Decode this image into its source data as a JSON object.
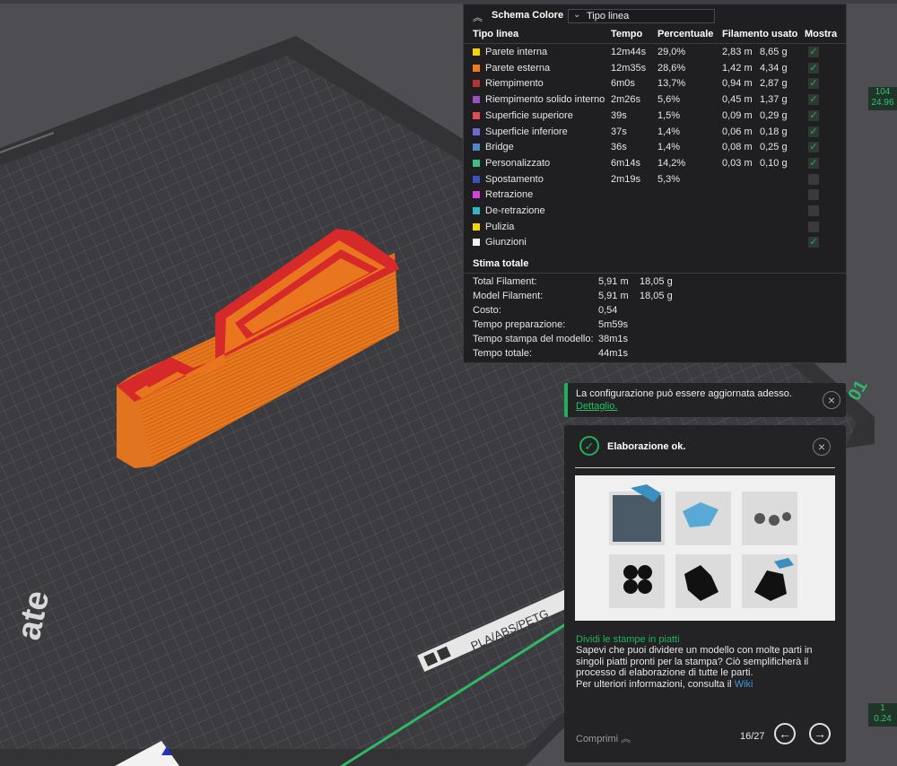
{
  "legend": {
    "title": "Schema Colore",
    "view_select": "Tipo linea",
    "columns": [
      "Tipo linea",
      "Tempo",
      "Percentuale",
      "Filamento usato",
      "Mostra"
    ],
    "rows": [
      {
        "label": "Parete interna",
        "color": "#f5d200",
        "time": "12m44s",
        "percent": "29,0%",
        "meters": "2,83 m",
        "grams": "8,65 g",
        "shown": true
      },
      {
        "label": "Parete esterna",
        "color": "#f07a1e",
        "time": "12m35s",
        "percent": "28,6%",
        "meters": "1,42 m",
        "grams": "4,34 g",
        "shown": true
      },
      {
        "label": "Riempimento",
        "color": "#b5332c",
        "time": "6m0s",
        "percent": "13,7%",
        "meters": "0,94 m",
        "grams": "2,87 g",
        "shown": true
      },
      {
        "label": "Riempimento solido interno",
        "color": "#9b4fc4",
        "time": "2m26s",
        "percent": "5,6%",
        "meters": "0,45 m",
        "grams": "1,37 g",
        "shown": true
      },
      {
        "label": "Superficie superiore",
        "color": "#e84b4b",
        "time": "39s",
        "percent": "1,5%",
        "meters": "0,09 m",
        "grams": "0,29 g",
        "shown": true
      },
      {
        "label": "Superficie inferiore",
        "color": "#6b6bd6",
        "time": "37s",
        "percent": "1,4%",
        "meters": "0,06 m",
        "grams": "0,18 g",
        "shown": true
      },
      {
        "label": "Bridge",
        "color": "#4f86c6",
        "time": "36s",
        "percent": "1,4%",
        "meters": "0,08 m",
        "grams": "0,25 g",
        "shown": true
      },
      {
        "label": "Personalizzato",
        "color": "#3fbf7f",
        "time": "6m14s",
        "percent": "14,2%",
        "meters": "0,03 m",
        "grams": "0,10 g",
        "shown": true
      },
      {
        "label": "Spostamento",
        "color": "#3d52b8",
        "time": "2m19s",
        "percent": "5,3%",
        "meters": "",
        "grams": "",
        "shown": false
      },
      {
        "label": "Retrazione",
        "color": "#d93fd9",
        "time": "",
        "percent": "",
        "meters": "",
        "grams": "",
        "shown": false
      },
      {
        "label": "De-retrazione",
        "color": "#2fb8c6",
        "time": "",
        "percent": "",
        "meters": "",
        "grams": "",
        "shown": false
      },
      {
        "label": "Pulizia",
        "color": "#f0d800",
        "time": "",
        "percent": "",
        "meters": "",
        "grams": "",
        "shown": false
      },
      {
        "label": "Giunzioni",
        "color": "#f2f2f2",
        "time": "",
        "percent": "",
        "meters": "",
        "grams": "",
        "shown": true
      }
    ],
    "estimate_title": "Stima totale",
    "estimates": [
      {
        "key": "Total Filament:",
        "v1": "5,91 m",
        "v2": "18,05 g"
      },
      {
        "key": "Model Filament:",
        "v1": "5,91 m",
        "v2": "18,05 g"
      },
      {
        "key": "Costo:",
        "v1": "0,54",
        "v2": ""
      },
      {
        "key": "Tempo preparazione:",
        "v1": "5m59s",
        "v2": ""
      },
      {
        "key": "Tempo stampa del modello:",
        "v1": "38m1s",
        "v2": ""
      },
      {
        "key": "Tempo totale:",
        "v1": "44m1s",
        "v2": ""
      }
    ]
  },
  "notification": {
    "message": "La configurazione può essere aggiornata adesso.",
    "link": "Dettaglio."
  },
  "tip": {
    "status": "Elaborazione ok.",
    "title": "Dividi le stampe in piatti",
    "body": "Sapevi che puoi dividere un modello con molte parti in singoli piatti pronti per la stampa? Ciò semplificherà il processo di elaborazione di tutte le parti.",
    "more": "Per ulteriori informazioni, consulta il",
    "wiki": "Wiki",
    "collapse": "Comprimi",
    "page": "16/27"
  },
  "plate": {
    "label": "PLA/ABS/PETG",
    "brand_fragment": "ate",
    "corner_text": "01"
  },
  "slider": {
    "top_layer": "104",
    "top_height": "24.96",
    "bottom_layer": "1",
    "bottom_height": "0.24"
  },
  "colors": {
    "accent": "#1fb25a",
    "model_orange": "#e8731c",
    "model_red": "#d82a2a"
  }
}
